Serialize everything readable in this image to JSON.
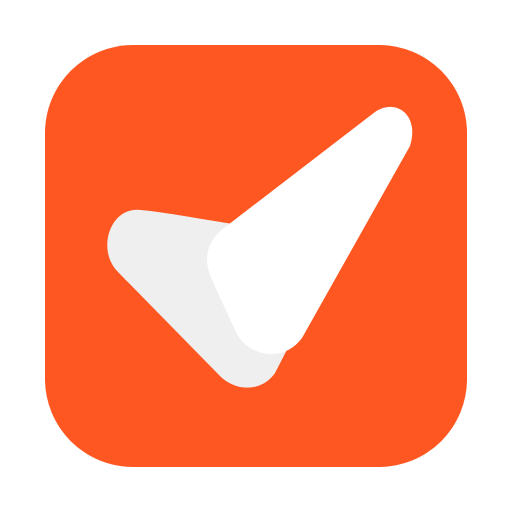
{
  "icon": {
    "name": "checkmark-app-icon",
    "glyph": "checkmark-icon"
  },
  "colors": {
    "background": "#ffffff",
    "tile": "#ff5722",
    "check_front": "#ffffff",
    "check_back": "#efefef"
  }
}
